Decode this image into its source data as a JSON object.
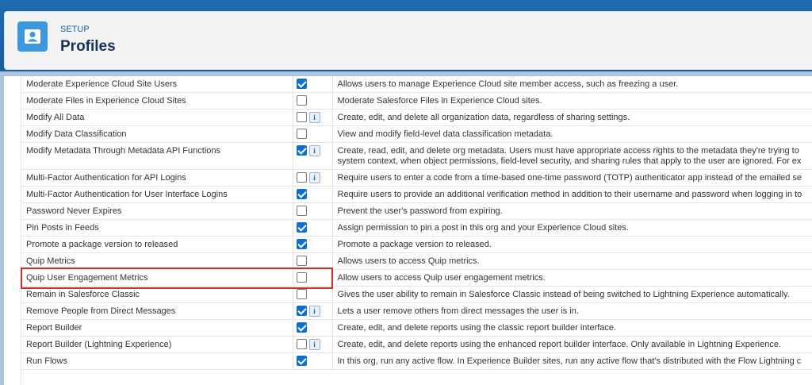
{
  "header": {
    "section": "SETUP",
    "title": "Profiles",
    "icon": "user-icon"
  },
  "colors": {
    "checked": "#0f6fd1",
    "highlight": "#d42a2a",
    "header_icon_bg": "#3c97dd"
  },
  "permissions": [
    {
      "name": "Moderate Experience Cloud Site Users",
      "checked": true,
      "info": false,
      "desc": [
        "Allows users to manage Experience Cloud site member access, such as freezing a user."
      ]
    },
    {
      "name": "Moderate Files in Experience Cloud Sites",
      "checked": false,
      "info": false,
      "desc": [
        "Moderate Salesforce Files in Experience Cloud sites."
      ]
    },
    {
      "name": "Modify All Data",
      "checked": false,
      "info": true,
      "desc": [
        "Create, edit, and delete all organization data, regardless of sharing settings."
      ]
    },
    {
      "name": "Modify Data Classification",
      "checked": false,
      "info": false,
      "desc": [
        "View and modify field-level data classification metadata."
      ]
    },
    {
      "name": "Modify Metadata Through Metadata API Functions",
      "checked": true,
      "info": true,
      "desc": [
        "Create, read, edit, and delete org metadata. Users must have appropriate access rights to the metadata they're trying to",
        "system context, when object permissions, field-level security, and sharing rules that apply to the user are ignored. For ex"
      ]
    },
    {
      "name": "Multi-Factor Authentication for API Logins",
      "checked": false,
      "info": true,
      "desc": [
        "Require users to enter a code from a time-based one-time password (TOTP) authenticator app instead of the emailed se"
      ]
    },
    {
      "name": "Multi-Factor Authentication for User Interface Logins",
      "checked": true,
      "info": false,
      "desc": [
        "Require users to provide an additional verification method in addition to their username and password when logging in to"
      ]
    },
    {
      "name": "Password Never Expires",
      "checked": false,
      "info": false,
      "desc": [
        "Prevent the user's password from expiring."
      ]
    },
    {
      "name": "Pin Posts in Feeds",
      "checked": true,
      "info": false,
      "desc": [
        "Assign permission to pin a post in this org and your Experience Cloud sites."
      ]
    },
    {
      "name": "Promote a package version to released",
      "checked": true,
      "info": false,
      "desc": [
        "Promote a package version to released."
      ]
    },
    {
      "name": "Quip Metrics",
      "checked": false,
      "info": false,
      "desc": [
        "Allows users to access Quip metrics."
      ]
    },
    {
      "name": "Quip User Engagement Metrics",
      "checked": false,
      "info": false,
      "desc": [
        "Allow users to access Quip user engagement metrics."
      ]
    },
    {
      "name": "Remain in Salesforce Classic",
      "checked": false,
      "info": false,
      "desc": [
        "Gives the user ability to remain in Salesforce Classic instead of being switched to Lightning Experience automatically."
      ]
    },
    {
      "name": "Remove People from Direct Messages",
      "checked": true,
      "info": true,
      "desc": [
        "Lets a user remove others from direct messages the user is in."
      ]
    },
    {
      "name": "Report Builder",
      "checked": true,
      "info": false,
      "desc": [
        "Create, edit, and delete reports using the classic report builder interface."
      ]
    },
    {
      "name": "Report Builder (Lightning Experience)",
      "checked": false,
      "info": true,
      "desc": [
        "Create, edit, and delete reports using the enhanced report builder interface. Only available in Lightning Experience."
      ]
    },
    {
      "name": "Run Flows",
      "checked": true,
      "info": false,
      "desc": [
        "In this org, run any active flow. In Experience Builder sites, run any active flow that's distributed with the Flow Lightning c"
      ]
    }
  ]
}
